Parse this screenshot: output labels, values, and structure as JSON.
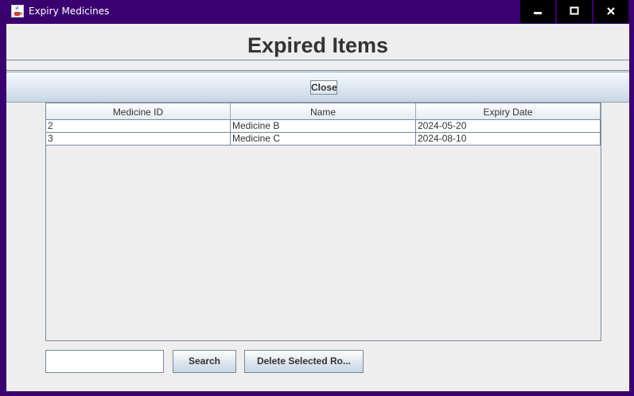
{
  "window": {
    "title": "Expiry Medicines",
    "icon": "java-cup-icon",
    "controls": [
      "minimize-icon",
      "maximize-icon",
      "close-icon"
    ]
  },
  "header": {
    "title": "Expired Items"
  },
  "toolbar": {
    "close_label": "Close"
  },
  "table": {
    "columns": [
      "Medicine ID",
      "Name",
      "Expiry Date"
    ],
    "rows": [
      [
        "2",
        "Medicine B",
        "2024-05-20"
      ],
      [
        "3",
        "Medicine C",
        "2024-08-10"
      ]
    ]
  },
  "footer": {
    "search_value": "",
    "search_label": "Search",
    "delete_label": "Delete Selected Ro..."
  },
  "colors": {
    "titlebar": "#3a0070",
    "window_bg": "#eeeeee",
    "text": "#333333"
  }
}
